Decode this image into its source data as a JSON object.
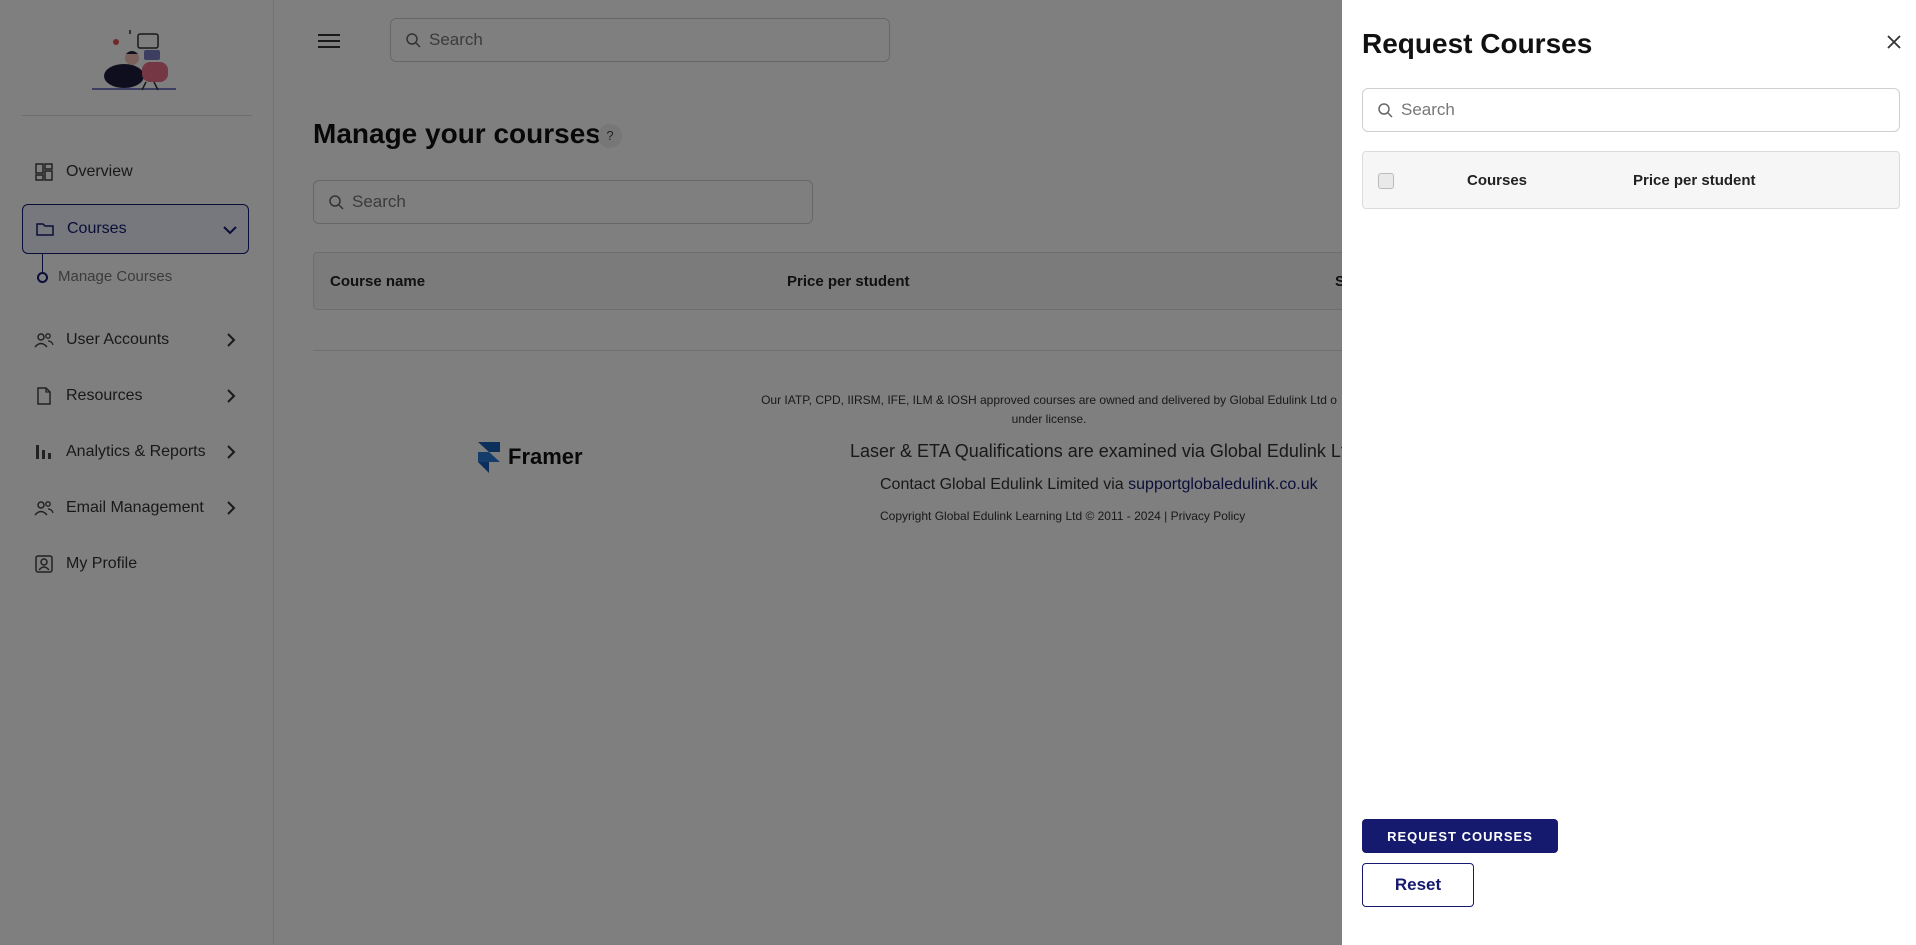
{
  "sidebar": {
    "items": [
      {
        "label": "Overview",
        "icon": "grid-icon"
      },
      {
        "label": "Courses",
        "icon": "folder-icon",
        "active": true
      },
      {
        "label": "User Accounts",
        "icon": "users-icon"
      },
      {
        "label": "Resources",
        "icon": "document-icon"
      },
      {
        "label": "Analytics & Reports",
        "icon": "bar-chart-icon"
      },
      {
        "label": "Email Management",
        "icon": "users-icon"
      },
      {
        "label": "My Profile",
        "icon": "profile-icon"
      }
    ],
    "subitem": "Manage Courses"
  },
  "header": {
    "search_placeholder": "Search"
  },
  "main": {
    "title": "Manage your courses",
    "help": "?",
    "search_placeholder": "Search",
    "table": {
      "columns": [
        "Course name",
        "Price per student",
        "S"
      ]
    }
  },
  "footer": {
    "brand": "Framer",
    "approval_line1": "Our IATP, CPD, IIRSM, IFE, ILM & IOSH approved courses are owned and delivered by Global Edulink Ltd o",
    "approval_line2": "under license.",
    "examined": "Laser & ETA Qualifications are examined via Global Edulink Ltd",
    "contact_prefix": "Contact Global Edulink Limited via",
    "contact_link": "supportglobaledulink.co.uk",
    "copyright": "Copyright Global Edulink Learning Ltd © 2011 - 2024 | Privacy Policy"
  },
  "drawer": {
    "title": "Request Courses",
    "search_placeholder": "Search",
    "table": {
      "columns": [
        "Courses",
        "Price per student"
      ]
    },
    "request_button": "REQUEST COURSES",
    "reset_button": "Reset"
  },
  "colors": {
    "primary": "#151a6e",
    "overlay": "rgba(0,0,0,0.5)"
  }
}
